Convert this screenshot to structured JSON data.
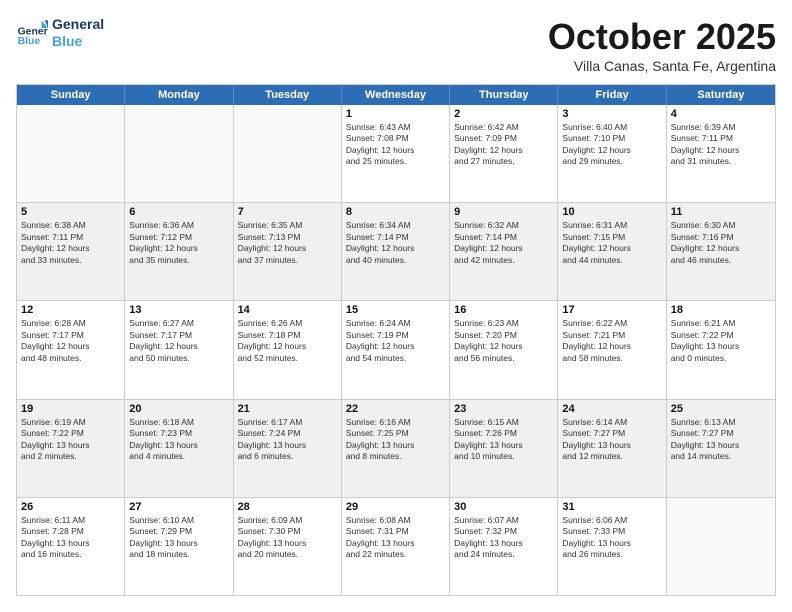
{
  "logo": {
    "line1": "General",
    "line2": "Blue"
  },
  "header": {
    "month": "October 2025",
    "location": "Villa Canas, Santa Fe, Argentina"
  },
  "dayHeaders": [
    "Sunday",
    "Monday",
    "Tuesday",
    "Wednesday",
    "Thursday",
    "Friday",
    "Saturday"
  ],
  "rows": [
    [
      {
        "day": "",
        "info": ""
      },
      {
        "day": "",
        "info": ""
      },
      {
        "day": "",
        "info": ""
      },
      {
        "day": "1",
        "info": "Sunrise: 6:43 AM\nSunset: 7:08 PM\nDaylight: 12 hours\nand 25 minutes."
      },
      {
        "day": "2",
        "info": "Sunrise: 6:42 AM\nSunset: 7:09 PM\nDaylight: 12 hours\nand 27 minutes."
      },
      {
        "day": "3",
        "info": "Sunrise: 6:40 AM\nSunset: 7:10 PM\nDaylight: 12 hours\nand 29 minutes."
      },
      {
        "day": "4",
        "info": "Sunrise: 6:39 AM\nSunset: 7:11 PM\nDaylight: 12 hours\nand 31 minutes."
      }
    ],
    [
      {
        "day": "5",
        "info": "Sunrise: 6:38 AM\nSunset: 7:11 PM\nDaylight: 12 hours\nand 33 minutes."
      },
      {
        "day": "6",
        "info": "Sunrise: 6:36 AM\nSunset: 7:12 PM\nDaylight: 12 hours\nand 35 minutes."
      },
      {
        "day": "7",
        "info": "Sunrise: 6:35 AM\nSunset: 7:13 PM\nDaylight: 12 hours\nand 37 minutes."
      },
      {
        "day": "8",
        "info": "Sunrise: 6:34 AM\nSunset: 7:14 PM\nDaylight: 12 hours\nand 40 minutes."
      },
      {
        "day": "9",
        "info": "Sunrise: 6:32 AM\nSunset: 7:14 PM\nDaylight: 12 hours\nand 42 minutes."
      },
      {
        "day": "10",
        "info": "Sunrise: 6:31 AM\nSunset: 7:15 PM\nDaylight: 12 hours\nand 44 minutes."
      },
      {
        "day": "11",
        "info": "Sunrise: 6:30 AM\nSunset: 7:16 PM\nDaylight: 12 hours\nand 46 minutes."
      }
    ],
    [
      {
        "day": "12",
        "info": "Sunrise: 6:28 AM\nSunset: 7:17 PM\nDaylight: 12 hours\nand 48 minutes."
      },
      {
        "day": "13",
        "info": "Sunrise: 6:27 AM\nSunset: 7:17 PM\nDaylight: 12 hours\nand 50 minutes."
      },
      {
        "day": "14",
        "info": "Sunrise: 6:26 AM\nSunset: 7:18 PM\nDaylight: 12 hours\nand 52 minutes."
      },
      {
        "day": "15",
        "info": "Sunrise: 6:24 AM\nSunset: 7:19 PM\nDaylight: 12 hours\nand 54 minutes."
      },
      {
        "day": "16",
        "info": "Sunrise: 6:23 AM\nSunset: 7:20 PM\nDaylight: 12 hours\nand 56 minutes."
      },
      {
        "day": "17",
        "info": "Sunrise: 6:22 AM\nSunset: 7:21 PM\nDaylight: 12 hours\nand 58 minutes."
      },
      {
        "day": "18",
        "info": "Sunrise: 6:21 AM\nSunset: 7:22 PM\nDaylight: 13 hours\nand 0 minutes."
      }
    ],
    [
      {
        "day": "19",
        "info": "Sunrise: 6:19 AM\nSunset: 7:22 PM\nDaylight: 13 hours\nand 2 minutes."
      },
      {
        "day": "20",
        "info": "Sunrise: 6:18 AM\nSunset: 7:23 PM\nDaylight: 13 hours\nand 4 minutes."
      },
      {
        "day": "21",
        "info": "Sunrise: 6:17 AM\nSunset: 7:24 PM\nDaylight: 13 hours\nand 6 minutes."
      },
      {
        "day": "22",
        "info": "Sunrise: 6:16 AM\nSunset: 7:25 PM\nDaylight: 13 hours\nand 8 minutes."
      },
      {
        "day": "23",
        "info": "Sunrise: 6:15 AM\nSunset: 7:26 PM\nDaylight: 13 hours\nand 10 minutes."
      },
      {
        "day": "24",
        "info": "Sunrise: 6:14 AM\nSunset: 7:27 PM\nDaylight: 13 hours\nand 12 minutes."
      },
      {
        "day": "25",
        "info": "Sunrise: 6:13 AM\nSunset: 7:27 PM\nDaylight: 13 hours\nand 14 minutes."
      }
    ],
    [
      {
        "day": "26",
        "info": "Sunrise: 6:11 AM\nSunset: 7:28 PM\nDaylight: 13 hours\nand 16 minutes."
      },
      {
        "day": "27",
        "info": "Sunrise: 6:10 AM\nSunset: 7:29 PM\nDaylight: 13 hours\nand 18 minutes."
      },
      {
        "day": "28",
        "info": "Sunrise: 6:09 AM\nSunset: 7:30 PM\nDaylight: 13 hours\nand 20 minutes."
      },
      {
        "day": "29",
        "info": "Sunrise: 6:08 AM\nSunset: 7:31 PM\nDaylight: 13 hours\nand 22 minutes."
      },
      {
        "day": "30",
        "info": "Sunrise: 6:07 AM\nSunset: 7:32 PM\nDaylight: 13 hours\nand 24 minutes."
      },
      {
        "day": "31",
        "info": "Sunrise: 6:06 AM\nSunset: 7:33 PM\nDaylight: 13 hours\nand 26 minutes."
      },
      {
        "day": "",
        "info": ""
      }
    ]
  ]
}
